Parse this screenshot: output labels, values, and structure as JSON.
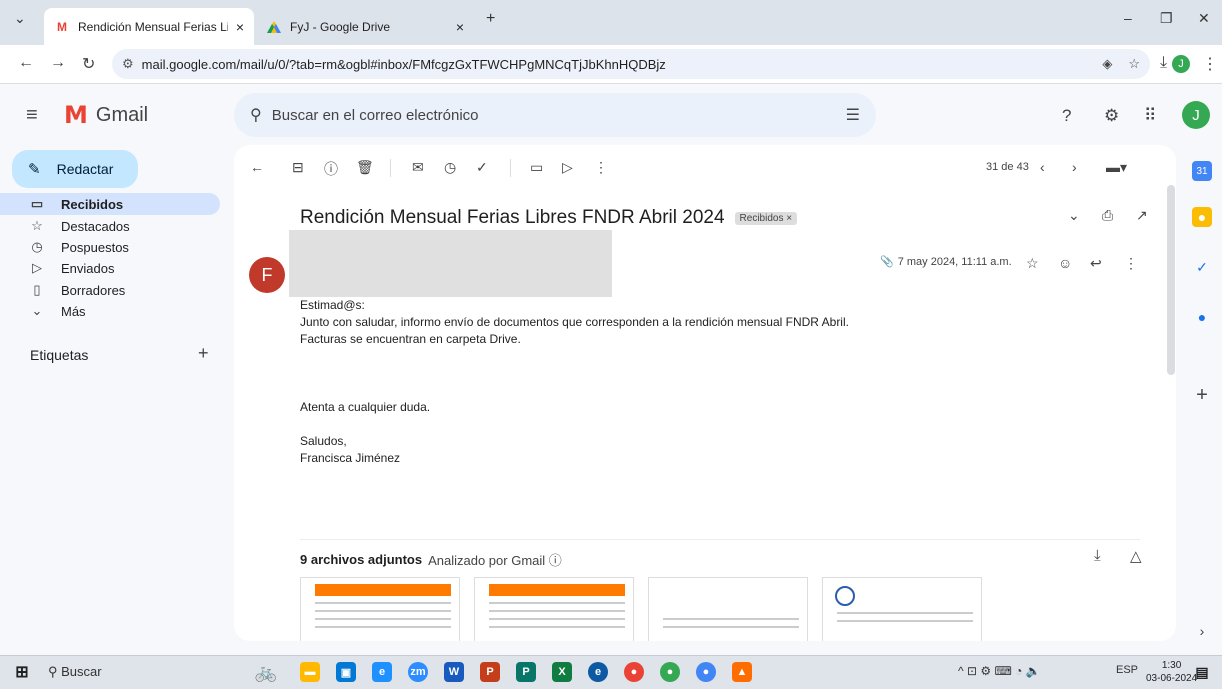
{
  "browser": {
    "tabs": [
      {
        "label": "Rendición Mensual Ferias Libres",
        "icon": "gmail-icon"
      },
      {
        "label": "FyJ - Google Drive",
        "icon": "drive-icon"
      }
    ],
    "url": "mail.google.com/mail/u/0/?tab=rm&ogbl#inbox/FMfcgzGxTFWCHPgMNCqTjJbKhnHQDBjz",
    "profile_initial": "J"
  },
  "gmail": {
    "app_name": "Gmail",
    "search_placeholder": "Buscar en el correo electrónico",
    "avatar_initial": "J",
    "compose_label": "Redactar",
    "nav": [
      {
        "label": "Recibidos",
        "icon": "inbox-icon",
        "active": true
      },
      {
        "label": "Destacados",
        "icon": "star-icon"
      },
      {
        "label": "Pospuestos",
        "icon": "clock-icon"
      },
      {
        "label": "Enviados",
        "icon": "send-icon"
      },
      {
        "label": "Borradores",
        "icon": "draft-icon"
      },
      {
        "label": "Más",
        "icon": "chevron-down-icon"
      }
    ],
    "labels_title": "Etiquetas",
    "pager": "31 de 43"
  },
  "email": {
    "subject": "Rendición Mensual Ferias Libres FNDR Abril 2024",
    "label_chip": "Recibidos ×",
    "sender_initial": "F",
    "date": "7 may 2024, 11:11 a.m.",
    "body": [
      "Estimad@s:",
      "",
      "Junto con saludar, informo envío de documentos que corresponden a la rendición mensual FNDR Abril.",
      "Facturas se encuentran en carpeta Drive.",
      "",
      "",
      "",
      "Atenta a cualquier duda.",
      "",
      "Saludos,",
      "Francisca Jiménez"
    ],
    "attachments_title": "9 archivos adjuntos",
    "attachments_scan": "Analizado por Gmail ⓘ"
  },
  "taskbar": {
    "search_label": "Buscar",
    "lang": "ESP",
    "time": "1:30",
    "date": "03-06-2024"
  }
}
